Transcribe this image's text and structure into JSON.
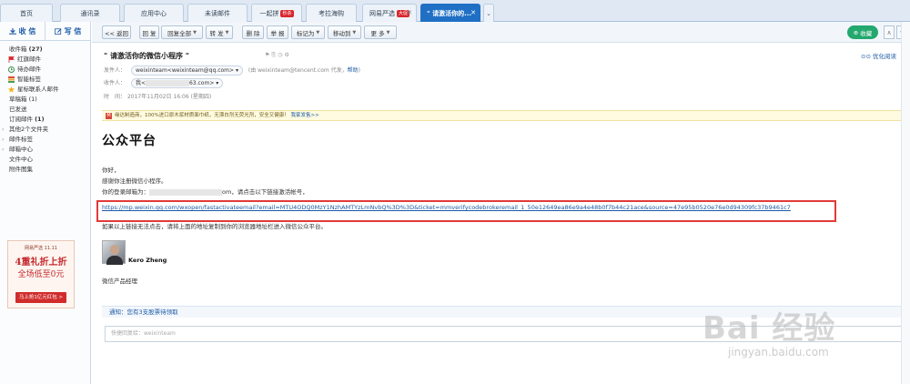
{
  "tabs": [
    {
      "label": "首页"
    },
    {
      "label": "通讯录"
    },
    {
      "label": "应用中心"
    },
    {
      "label": "未读邮件"
    },
    {
      "label": "一起拼",
      "badge": "秒杀"
    },
    {
      "label": "考拉海购"
    },
    {
      "label": "网易严选",
      "badge": "大促"
    },
    {
      "label": "\" 请激活你的...",
      "active": true
    }
  ],
  "sidebar": {
    "receive": "收 信",
    "compose": "写 信",
    "items": [
      {
        "label": "收件箱",
        "count": "(27)"
      },
      {
        "label": "红旗邮件",
        "icon": "red-flag-icon"
      },
      {
        "label": "待办邮件",
        "icon": "clock-icon"
      },
      {
        "label": "智能标签",
        "icon": "tag-stack-icon"
      },
      {
        "label": "星标联系人邮件",
        "icon": "star-icon"
      },
      {
        "label": "草稿箱",
        "count": "(1)"
      },
      {
        "label": "已发送"
      },
      {
        "label": "订阅邮件",
        "count": "(1)"
      },
      {
        "label": "其他2个文件夹",
        "expand": true
      },
      {
        "label": "邮件标签",
        "expand": true
      },
      {
        "label": "邮箱中心",
        "expand": true
      },
      {
        "label": "文件中心"
      },
      {
        "label": "附件图集"
      }
    ],
    "ad": {
      "line1": "网易严选 11.11",
      "line2": "4重礼折上折",
      "line3": "全场低至0元",
      "cta": "马上抢1亿元红包 >"
    }
  },
  "toolbar": {
    "back": "<< 返回",
    "reply": "回 复",
    "reply_all": "回复全部",
    "forward": "转 发",
    "delete": "删 除",
    "report": "举 报",
    "mark_as": "标记为",
    "move_to": "移动到",
    "more": "更 多",
    "collect": "收藏"
  },
  "email": {
    "subject": "\" 请激活你的微信小程序 \"",
    "from_label": "发件人：",
    "from_chip": "weixinteam<weixinteam@qq.com>",
    "via_text": "(由 weixinteam@tencent.com 代发，",
    "help_link": "帮助",
    "via_close": ")",
    "to_label": "收件人：",
    "to_chip_prefix": "我<",
    "to_chip_suffix": "63.com>",
    "time_label": "时　间：",
    "time_value": "2017年11月02日 16:06 (星期四)",
    "optimize_read": "优化阅读",
    "banner_text": "缘达制造商，100%进口原木浆材质面巾纸，无漂白剂无荧光剂，安全又健康！",
    "banner_link": "我家发售>>",
    "heading": "公众平台",
    "greeting": "你好，",
    "thanks": "感谢你注册微信小程序。",
    "login_prefix": "你的登录邮箱为：",
    "login_suffix": "om，请点击以下链接激活帐号，",
    "activation_link": "https://mp.weixin.qq.com/wxopen/fastactivateemail?email=MTU4ODQ0MzY1NzhAMTYzLmNvbQ%3D%3D&ticket=mmverifycodebrokeremail_1_50e12649ea86e9a4e48b0f7b44c21ace&source=47e95b0520e76e0d94309fc37b9461c7",
    "fallback_text": "如果以上链接无法点击，请将上面的地址复制到你的浏览器地址栏进入微信公众平台。",
    "signature_name": "Kero Zheng",
    "signature_title": "微信产品经理",
    "notice": "通知：您有3支股票待领取",
    "quick_reply_placeholder": "快捷回复给：weixinteam"
  },
  "watermark": {
    "big": "Bai 经验",
    "small": "jingyan.baidu.com"
  },
  "colors": {
    "accent": "#1f6fc5",
    "link": "#1b5aa6",
    "highlight_box": "#e23a3a",
    "collect_green": "#23a86d"
  }
}
